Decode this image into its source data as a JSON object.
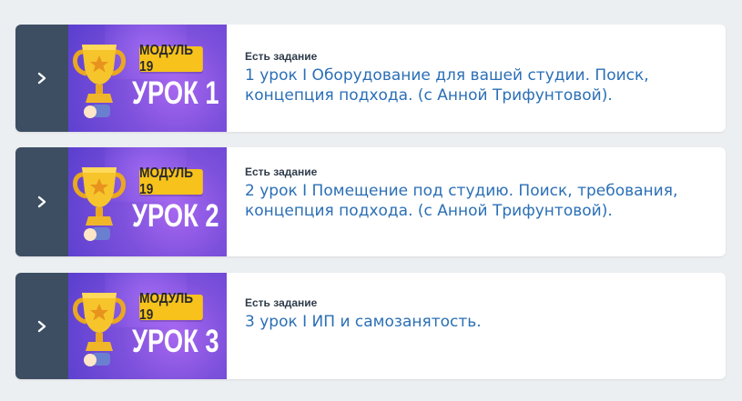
{
  "lessons": [
    {
      "module_badge": "МОДУЛЬ 19",
      "lesson_badge": "УРОК 1",
      "task_label": "Есть задание",
      "title": "1 урок I Оборудование для вашей студии. Поиск, концепция подхода. (с Анной Трифунтовой)."
    },
    {
      "module_badge": "МОДУЛЬ 19",
      "lesson_badge": "УРОК 2",
      "task_label": "Есть задание",
      "title": "2 урок I Помещение под студию. Поиск, требования, концепция подхода. (с Анной Трифунтовой)."
    },
    {
      "module_badge": "МОДУЛЬ 19",
      "lesson_badge": "УРОК 3",
      "task_label": "Есть задание",
      "title": "3 урок I ИП и самозанятость."
    }
  ],
  "icons": {
    "toggle": "chevron-right-icon",
    "thumbnail": "trophy-icon"
  },
  "colors": {
    "page_bg": "#eceff1",
    "toggle_bg": "#3d4e63",
    "thumb_bg": "#7c50db",
    "badge_bg": "#f7c21b",
    "title": "#2b6fb6",
    "label": "#2f3b4a"
  }
}
